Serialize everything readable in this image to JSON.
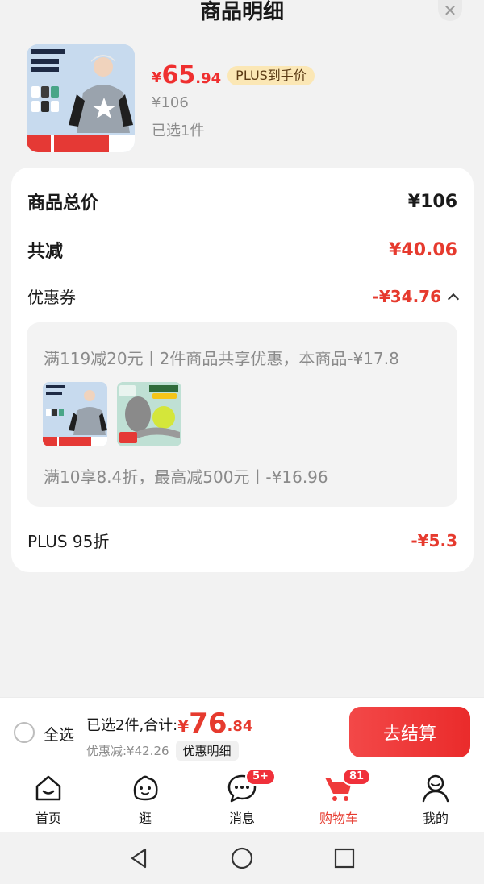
{
  "sheet": {
    "title": "商品明细",
    "close_icon": "close-icon"
  },
  "product": {
    "image_icon": "kids-sweatshirt-product-image",
    "currency": "¥",
    "price_int": "65",
    "price_dec": ".94",
    "plus_tag": "PLUS到手价",
    "original_price": "¥106",
    "selected": "已选1件"
  },
  "detail": {
    "total_label": "商品总价",
    "total_value": "¥106",
    "reduce_label": "共减",
    "reduce_value": "¥40.06",
    "coupon_label": "优惠券",
    "coupon_value": "-¥34.76",
    "coupon_lines": [
      "满119减20元丨2件商品共享优惠，本商品-¥17.8",
      "满10享8.4折，最高减500元丨-¥16.96"
    ],
    "plus_label": "PLUS 95折",
    "plus_value": "-¥5.3"
  },
  "checkout": {
    "select_all": "全选",
    "summary_label": "已选2件,合计:",
    "currency": "¥",
    "total_int": "76",
    "total_dec": ".84",
    "discount_text": "优惠减:¥42.26",
    "detail_button": "优惠明细",
    "checkout_button": "去结算"
  },
  "tabs": [
    {
      "label": "首页",
      "icon": "home-icon"
    },
    {
      "label": "逛",
      "icon": "browse-face-icon"
    },
    {
      "label": "消息",
      "icon": "message-icon",
      "badge": "5+"
    },
    {
      "label": "购物车",
      "icon": "cart-icon",
      "badge": "81",
      "active": true
    },
    {
      "label": "我的",
      "icon": "user-icon"
    }
  ],
  "colors": {
    "accent": "#e63a2e",
    "plus_tag_bg": "#fbe7b5",
    "checkout_button": "#ef3939"
  }
}
